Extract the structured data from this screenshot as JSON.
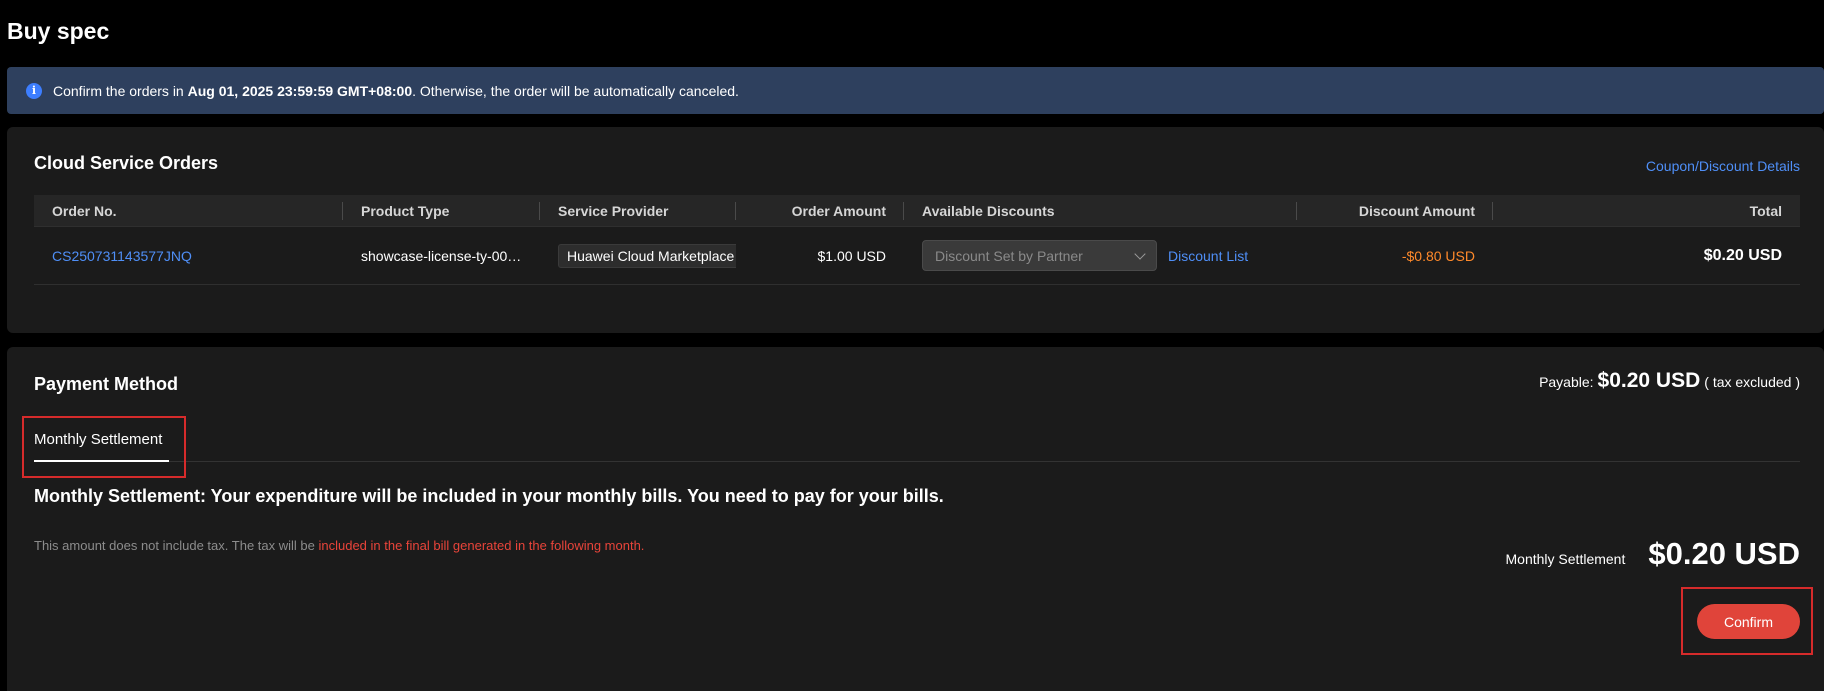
{
  "page": {
    "title": "Buy spec"
  },
  "notice": {
    "prefix": "Confirm the orders in ",
    "deadline": "Aug 01, 2025 23:59:59 GMT+08:00",
    "suffix": ". Otherwise, the order will be automatically canceled."
  },
  "orders": {
    "title": "Cloud Service Orders",
    "coupon_link": "Coupon/Discount Details",
    "columns": [
      "Order No.",
      "Product Type",
      "Service Provider",
      "Order Amount",
      "Available Discounts",
      "Discount Amount",
      "Total"
    ],
    "rows": [
      {
        "order_no": "CS250731143577JNQ",
        "product_type": "showcase-license-ty-00…",
        "provider": "Huawei Cloud Marketplace",
        "order_amount": "$1.00 USD",
        "discount_select": "Discount Set by Partner",
        "discount_list": "Discount List",
        "discount_amount": "-$0.80 USD",
        "total": "$0.20 USD"
      }
    ]
  },
  "payment": {
    "title": "Payment Method",
    "payable_label": "Payable:",
    "payable_amount": "$0.20 USD",
    "payable_note": "( tax excluded )",
    "tab_label": "Monthly Settlement",
    "description": "Monthly Settlement: Your expenditure will be included in your monthly bills. You need to pay for your bills.",
    "tax_note_prefix": "This amount does not include tax. The tax will be ",
    "tax_note_highlight": "included in the final bill generated in the following month.",
    "settle_label": "Monthly Settlement",
    "settle_amount": "$0.20 USD",
    "confirm_label": "Confirm"
  },
  "icons": {
    "info": "info-icon",
    "dropdown": "chevron-down-icon"
  },
  "colors": {
    "accent_link": "#4f8ff7",
    "confirm": "#e0443a",
    "discount": "#ff8a2b",
    "notice_bg": "#2e405e"
  }
}
